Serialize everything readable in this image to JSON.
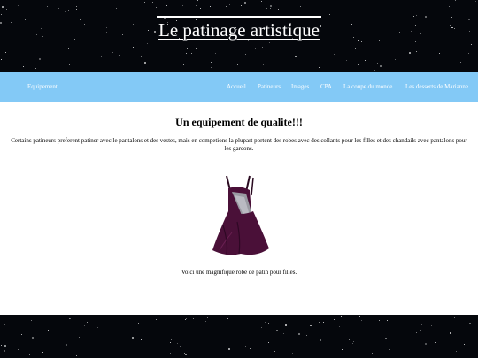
{
  "header": {
    "title": "Le patinage artistique"
  },
  "nav": {
    "brand": "Equipement",
    "items": [
      {
        "label": "Accueil"
      },
      {
        "label": "Patineurs"
      },
      {
        "label": "Images"
      },
      {
        "label": "CPA"
      },
      {
        "label": "La coupe du monde"
      },
      {
        "label": "Les desserts de Marianne"
      }
    ],
    "color": "#83c9f6"
  },
  "main": {
    "heading": "Un equipement de qualite!!!",
    "paragraph": "Certains patineurs preferent patiner avec le pantalons et des vestes, mais en competions la plupart portent des robes avec des collants pour les filles et des chandails avec pantalons pour les garcons.",
    "image": {
      "icon": "skating-dress-image"
    },
    "caption": "Voici une magnifique robe de patin pour filles."
  },
  "colors": {
    "starfield": "#05070c",
    "dress": "#4a1038",
    "sequins": "#9a9aa2"
  }
}
